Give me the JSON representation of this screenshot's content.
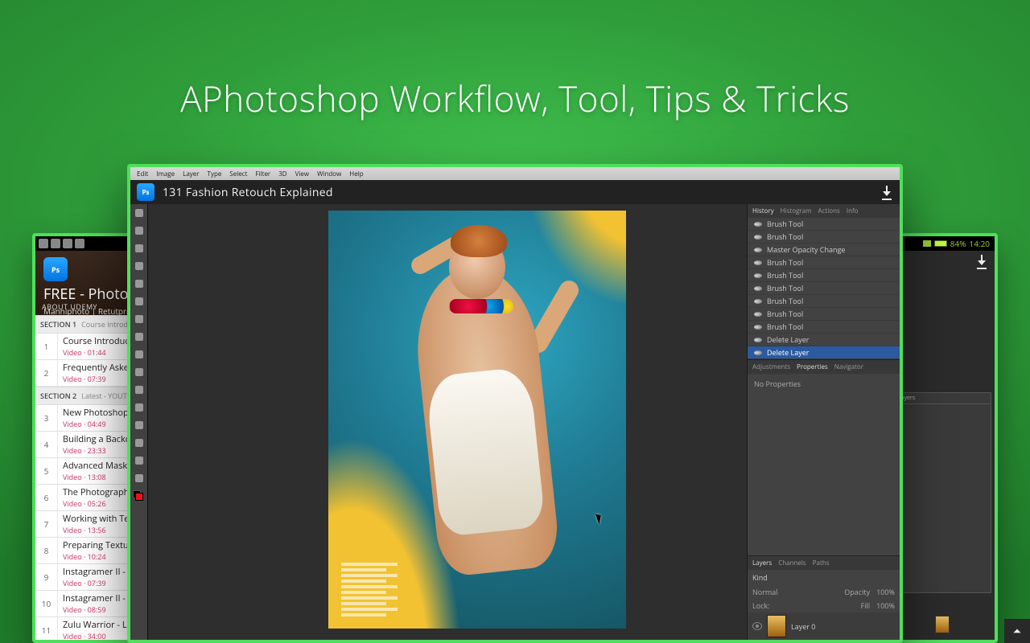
{
  "headline": "APhotoshop Workflow, Tool, Tips & Tricks",
  "center": {
    "menu": [
      "Edit",
      "Image",
      "Layer",
      "Type",
      "Select",
      "Filter",
      "3D",
      "View",
      "Window",
      "Help"
    ],
    "app_badge": "Ps",
    "video_title": "131  Fashion Retouch Explained",
    "history": {
      "tabs": [
        "History",
        "Histogram",
        "Actions",
        "Info"
      ],
      "items": [
        {
          "label": "Brush Tool"
        },
        {
          "label": "Brush Tool"
        },
        {
          "label": "Master Opacity Change"
        },
        {
          "label": "Brush Tool"
        },
        {
          "label": "Brush Tool"
        },
        {
          "label": "Brush Tool"
        },
        {
          "label": "Brush Tool"
        },
        {
          "label": "Brush Tool"
        },
        {
          "label": "Brush Tool"
        },
        {
          "label": "Delete Layer"
        },
        {
          "label": "Delete Layer",
          "selected": true
        }
      ]
    },
    "properties": {
      "tabs": [
        "Adjustments",
        "Properties",
        "Navigator"
      ],
      "body": "No Properties"
    },
    "layers": {
      "tabs": [
        "Layers",
        "Channels",
        "Paths"
      ],
      "kind_label": "Kind",
      "blend_mode": "Normal",
      "opacity_label": "Opacity",
      "opacity_value": "100%",
      "lock_label": "Lock:",
      "fill_label": "Fill",
      "fill_value": "100%",
      "layer_name": "Layer 0"
    }
  },
  "left": {
    "app_badge": "Ps",
    "course_title": "FREE - Photoshop",
    "course_subtitle": "Manniphoto  | Retutpro",
    "tab_label": "ABOUT UDEMY",
    "sections": [
      {
        "label": "SECTION 1",
        "name": "Course Introduction",
        "items": [
          {
            "n": 1,
            "title": "Course Introduction",
            "meta": "Video · 01:44"
          },
          {
            "n": 2,
            "title": "Frequently Asked",
            "meta": "Video · 07:39"
          }
        ]
      },
      {
        "label": "SECTION 2",
        "name": "Latest - YOUTUBE",
        "items": [
          {
            "n": 3,
            "title": "New Photoshop",
            "meta": "Video · 04:49"
          },
          {
            "n": 4,
            "title": "Building a Backdrop",
            "meta": "Video · 23:33"
          },
          {
            "n": 5,
            "title": "Advanced Masking",
            "meta": "Video · 13:08"
          },
          {
            "n": 6,
            "title": "The Photographer",
            "meta": "Video · 05:26"
          },
          {
            "n": 7,
            "title": "Working with Text",
            "meta": "Video · 13:56"
          },
          {
            "n": 8,
            "title": "Preparing Textures",
            "meta": "Video · 10:24"
          },
          {
            "n": 9,
            "title": "Instagramer II -",
            "meta": "Video · 07:39"
          },
          {
            "n": 10,
            "title": "Instagramer II -",
            "meta": "Video · 08:59"
          },
          {
            "n": 11,
            "title": "Zulu Warrior - L",
            "meta": "Video · 34:00"
          }
        ]
      }
    ]
  },
  "right": {
    "battery": "84%",
    "clock": "14:20"
  }
}
